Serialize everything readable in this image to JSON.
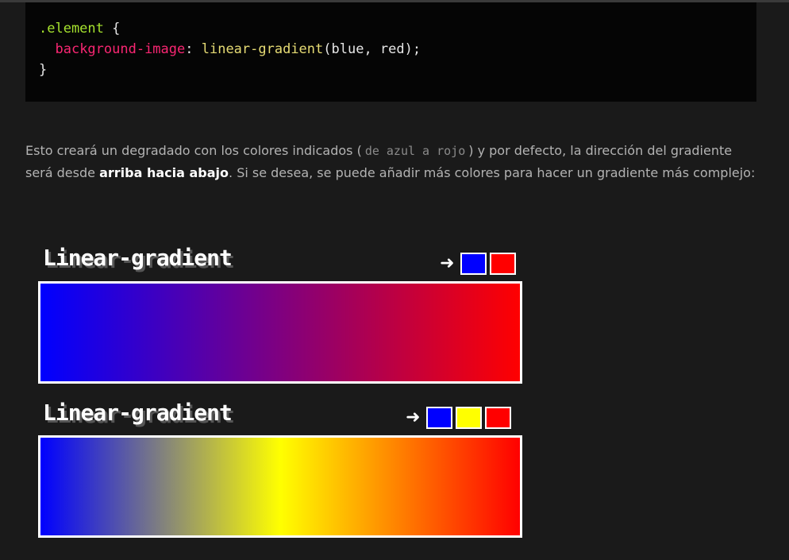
{
  "code": {
    "line1_selector": ".element",
    "line1_brace": " {",
    "line2_indent": "  ",
    "line2_property": "background-image",
    "line2_colon": ": ",
    "line2_function": "linear-gradient",
    "line2_args": "(blue, red);",
    "line3_brace": "}"
  },
  "paragraph": {
    "part1": "Esto creará un degradado con los colores indicados (",
    "code_text": "de azul a rojo",
    "part2": ") y por defecto, la dirección del gradiente será desde ",
    "bold_text": "arriba hacia abajo",
    "part3": ". Si se desea, se puede añadir más colores para hacer un gradiente más complejo:"
  },
  "examples": [
    {
      "title": "Linear-gradient",
      "arrow": "➜",
      "colors": [
        "#0000ff",
        "#ff0000"
      ]
    },
    {
      "title": "Linear-gradient",
      "arrow": "➜",
      "colors": [
        "#0000ff",
        "#ffff00",
        "#ff0000"
      ]
    }
  ]
}
